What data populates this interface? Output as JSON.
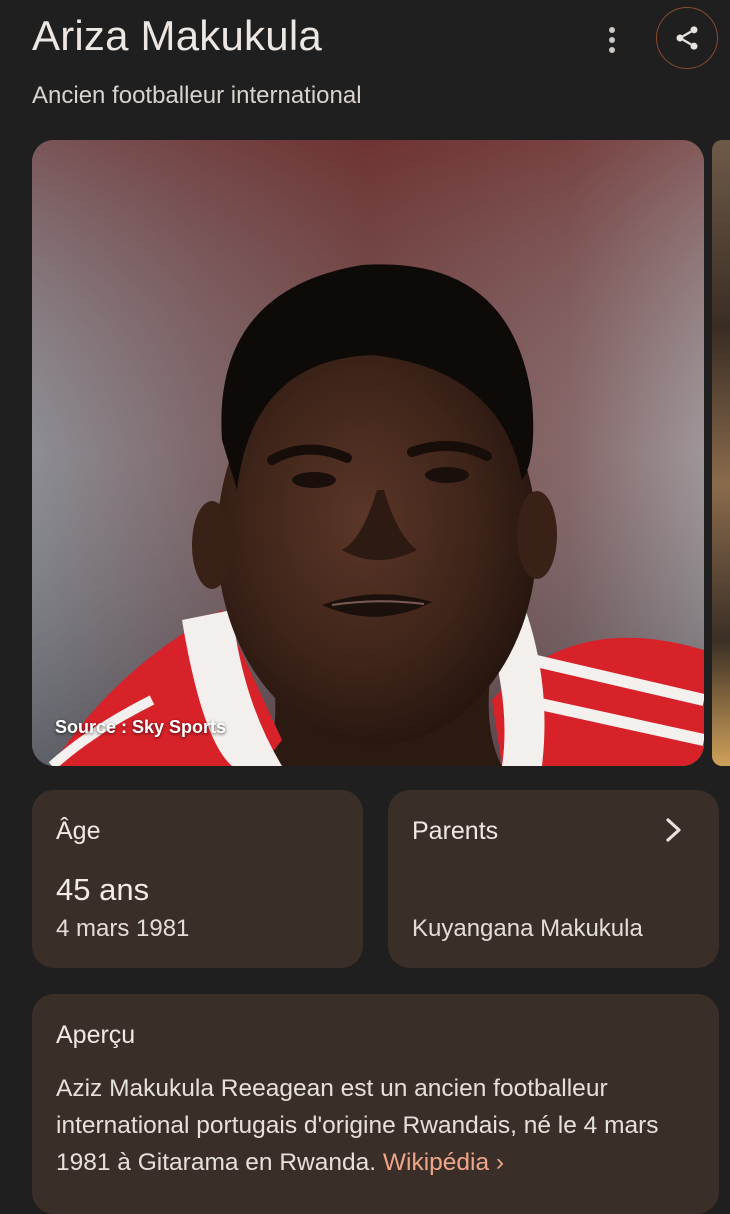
{
  "header": {
    "title": "Ariza Makukula",
    "subtitle": "Ancien footballeur international"
  },
  "photo": {
    "source": "Source : Sky Sports"
  },
  "age_card": {
    "label": "Âge",
    "value": "45 ans",
    "date": "4 mars 1981"
  },
  "parents_card": {
    "label": "Parents",
    "value": "Kuyangana Makukula"
  },
  "overview_card": {
    "label": "Aperçu",
    "text": "Aziz Makukula Reeagean est un ancien footballeur international portugais d'origine Rwandais, né le 4 mars 1981 à Gitarama en Rwanda.",
    "link": "Wikipédia",
    "link_chevron": "›"
  },
  "icons": {
    "more": "more-vert-icon",
    "share": "share-icon",
    "chevron": "chevron-right-icon"
  },
  "colors": {
    "background": "#1f1f1f",
    "card": "#3a2e29",
    "accent_link": "#f0a58a",
    "share_ring": "#8a4a2f"
  }
}
